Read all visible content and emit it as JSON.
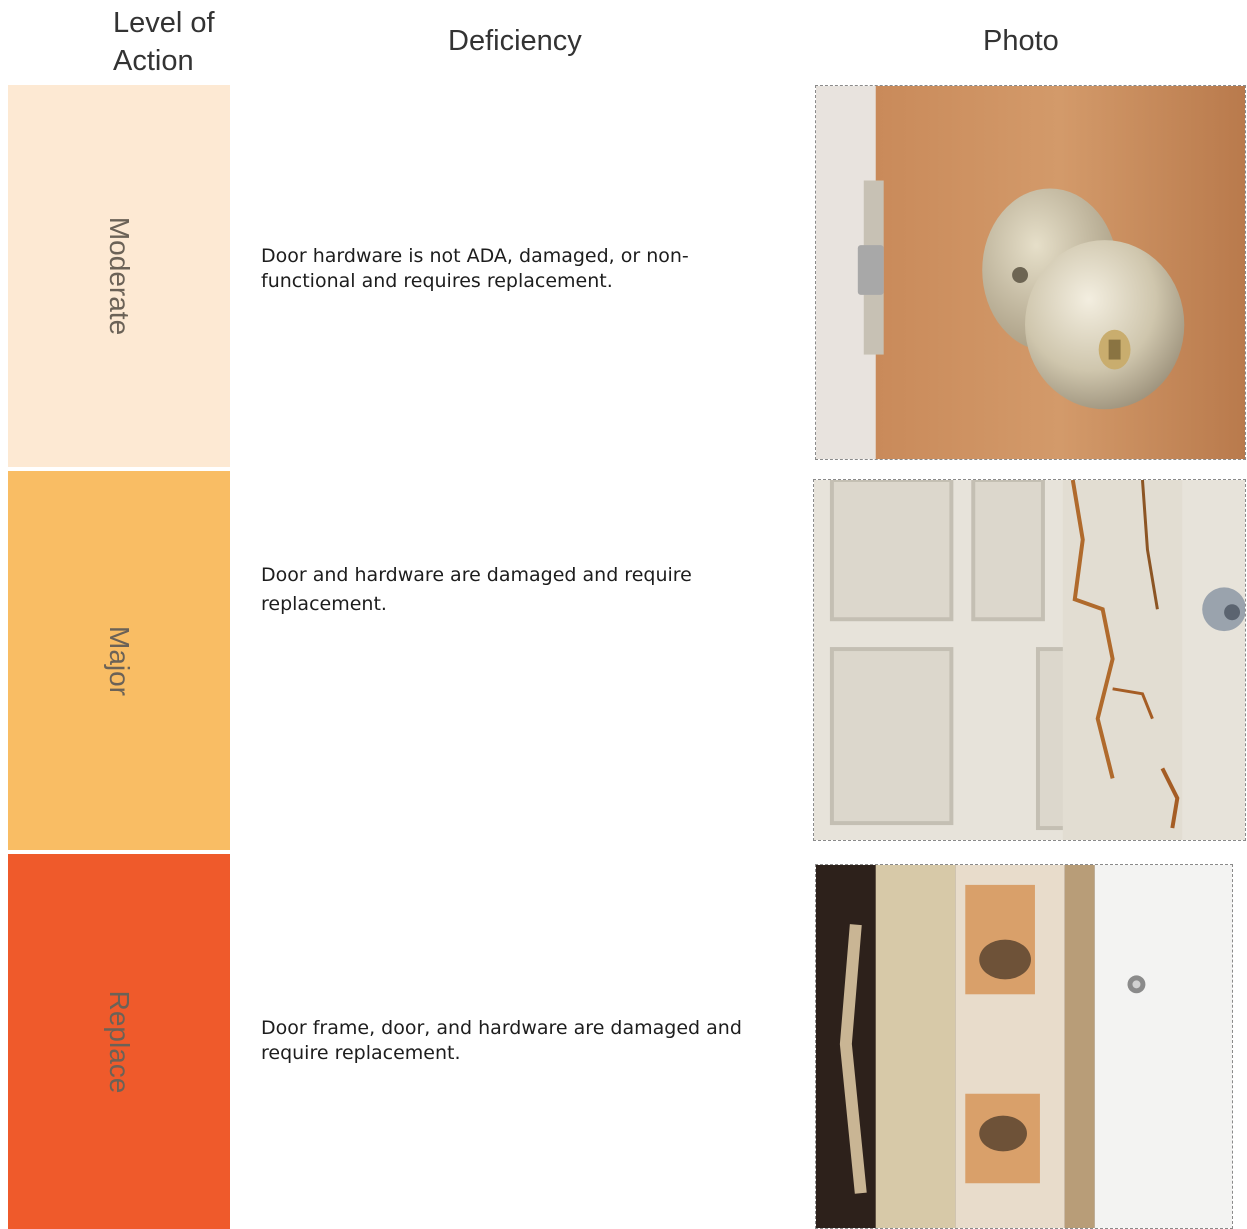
{
  "headers": {
    "level": "Level of Action",
    "deficiency": "Deficiency",
    "photo": "Photo"
  },
  "rows": [
    {
      "level": "Moderate",
      "level_color": "#fde9d3",
      "deficiency": "Door hardware is not ADA, damaged, or non-functional and requires replacement."
    },
    {
      "level": "Major",
      "level_color": "#f9bd64",
      "deficiency": "Door and hardware are damaged and require replacement."
    },
    {
      "level": "Replace",
      "level_color": "#ef5a2b",
      "deficiency": "Door frame, door, and hardware are damaged and require replacement."
    }
  ]
}
